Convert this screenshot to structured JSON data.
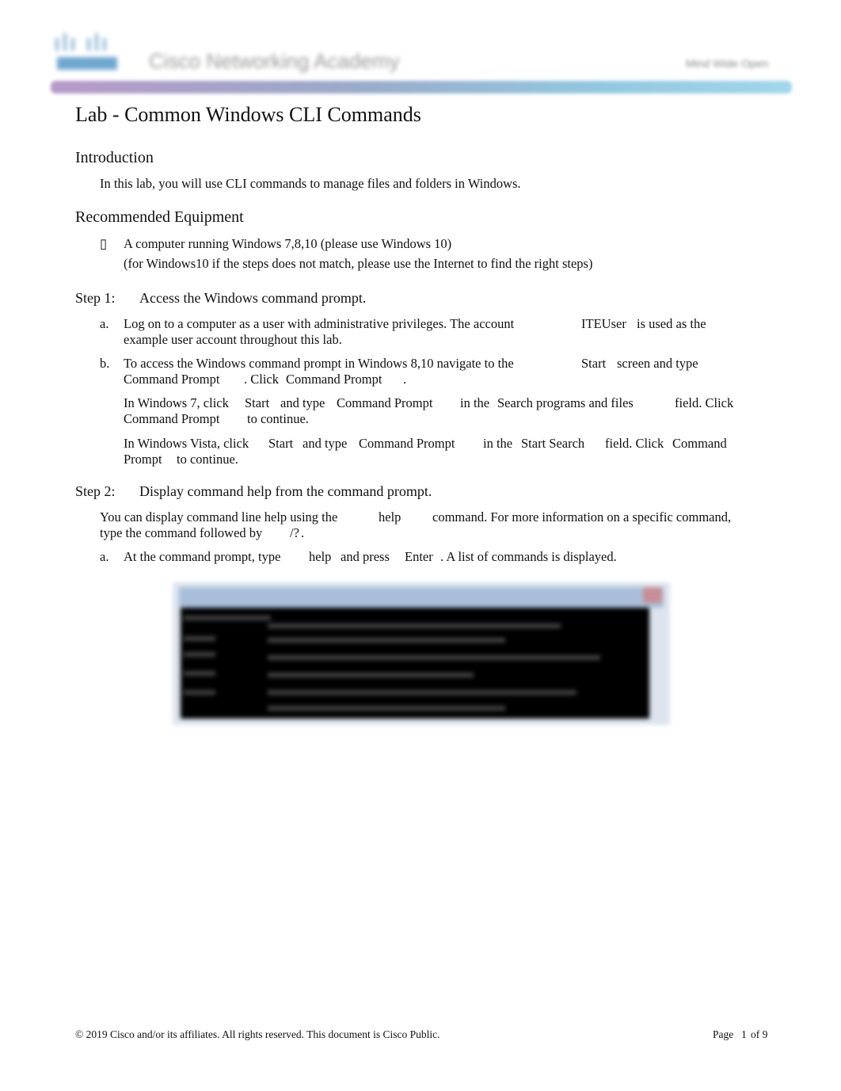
{
  "header": {
    "logo_text": "Cisco Networking Academy",
    "tagline": "Mind Wide Open"
  },
  "title": "Lab - Common Windows CLI Commands",
  "introduction": {
    "heading": "Introduction",
    "text": "In this lab, you will use CLI commands to manage files and folders in Windows."
  },
  "equipment": {
    "heading": "Recommended Equipment",
    "bullet": "",
    "line1": "A computer running Windows 7,8,10 (please use Windows 10)",
    "line2": "(for Windows10 if the steps does not match, please use the Internet to find the right steps)"
  },
  "step1": {
    "label": "Step 1:",
    "heading": "Access the Windows command prompt.",
    "a": {
      "marker": "a.",
      "t1": "Log on to a computer as a user with administrative privileges. The account",
      "t2": "ITEUser",
      "t3": "is used as the",
      "t4": "example user account throughout this lab."
    },
    "b": {
      "marker": "b.",
      "t1": "To access the Windows command prompt in Windows 8,10 navigate to the",
      "t2": "Start",
      "t3": "screen and type",
      "t4": "Command Prompt",
      "t5": ". Click",
      "t6": "Command Prompt",
      "t7": "."
    },
    "win7": {
      "t1": "In Windows 7, click",
      "t2": "Start",
      "t3": "and type",
      "t4": "Command Prompt",
      "t5": "in the",
      "t6": "Search programs and files",
      "t7": "field. Click",
      "t8": "Command Prompt",
      "t9": "to continue."
    },
    "vista": {
      "t1": "In Windows Vista, click",
      "t2": "Start",
      "t3": "and type",
      "t4": "Command Prompt",
      "t5": "in the",
      "t6": "Start Search",
      "t7": "field. Click",
      "t8": "Command",
      "t9": "Prompt",
      "t10": "to continue."
    }
  },
  "step2": {
    "label": "Step 2:",
    "heading": "Display command help from the command prompt.",
    "intro": {
      "t1": "You can display command line help using the",
      "t2": "help",
      "t3": "command. For more information on a specific command,",
      "t4": "type the command followed by",
      "t5": "/?",
      "t6": "."
    },
    "a": {
      "marker": "a.",
      "t1": "At the command prompt, type",
      "t2": "help",
      "t3": "and press",
      "t4": "Enter",
      "t5": ". A list of commands is displayed."
    }
  },
  "footer": {
    "copyright": "© 2019 Cisco and/or its affiliates. All rights reserved. This document is Cisco Public.",
    "page_label": "Page",
    "page_num": "1",
    "page_of": "of 9"
  }
}
